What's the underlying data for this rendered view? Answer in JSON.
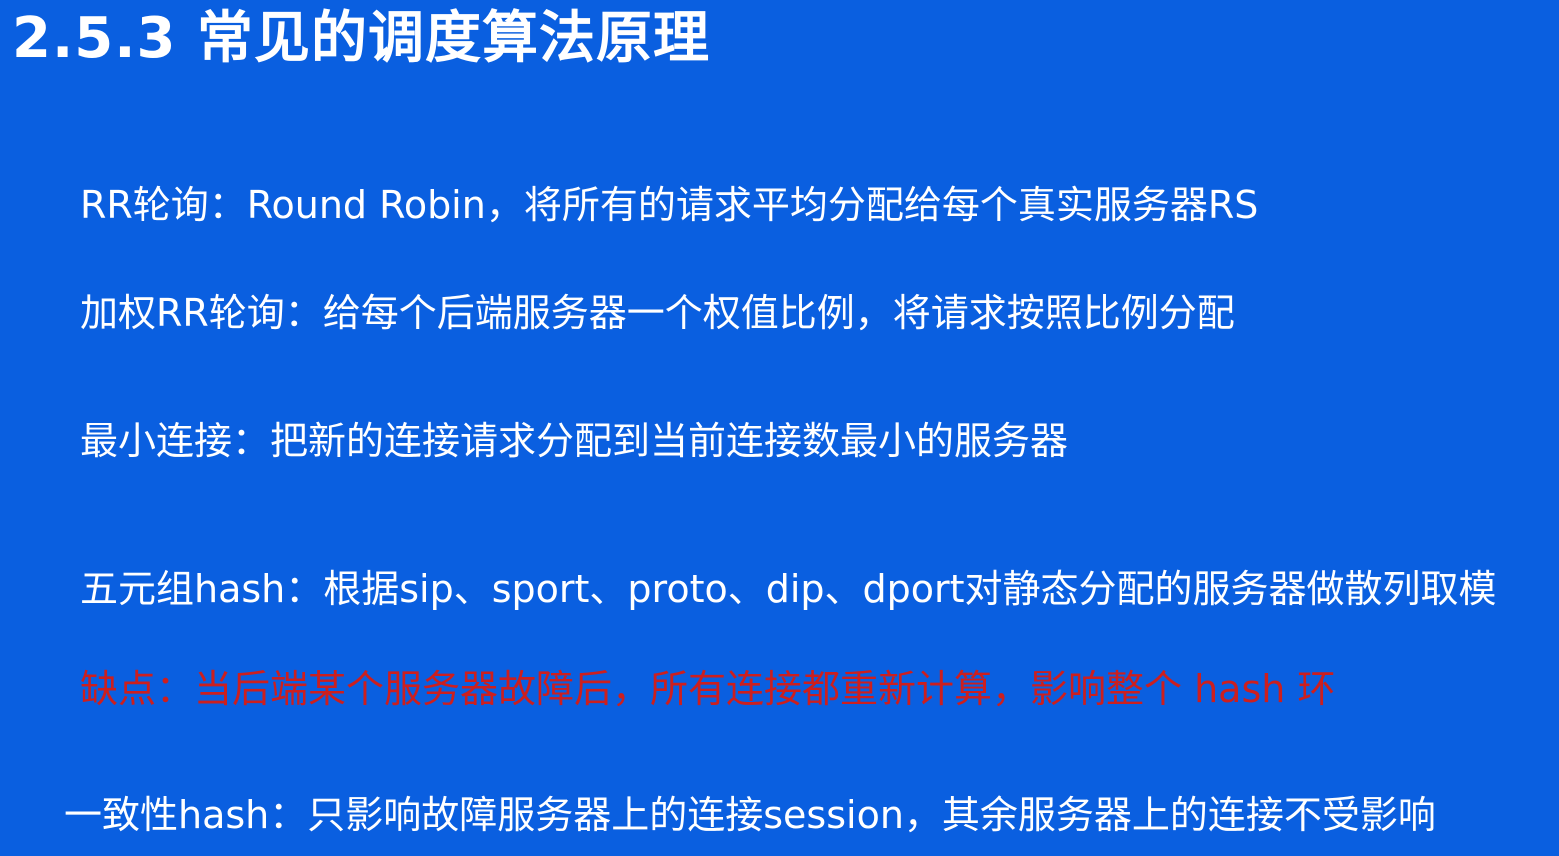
{
  "slide": {
    "title": "2.5.3 常见的调度算法原理",
    "items": [
      {
        "text": "RR轮询：Round Robin，将所有的请求平均分配给每个真实服务器RS"
      },
      {
        "text": "加权RR轮询：给每个后端服务器一个权值比例，将请求按照比例分配"
      },
      {
        "text": "最小连接：把新的连接请求分配到当前连接数最小的服务器"
      },
      {
        "text": "五元组hash：根据sip、sport、proto、dip、dport对静态分配的服务器做散列取模"
      },
      {
        "text": "缺点：当后端某个服务器故障后，所有连接都重新计算，影响整个 hash 环"
      },
      {
        "text": "一致性hash：只影响故障服务器上的连接session，其余服务器上的连接不受影响"
      }
    ]
  },
  "colors": {
    "background": "#0a5fe0",
    "text": "#ffffff",
    "warning": "#cc1f1f"
  }
}
